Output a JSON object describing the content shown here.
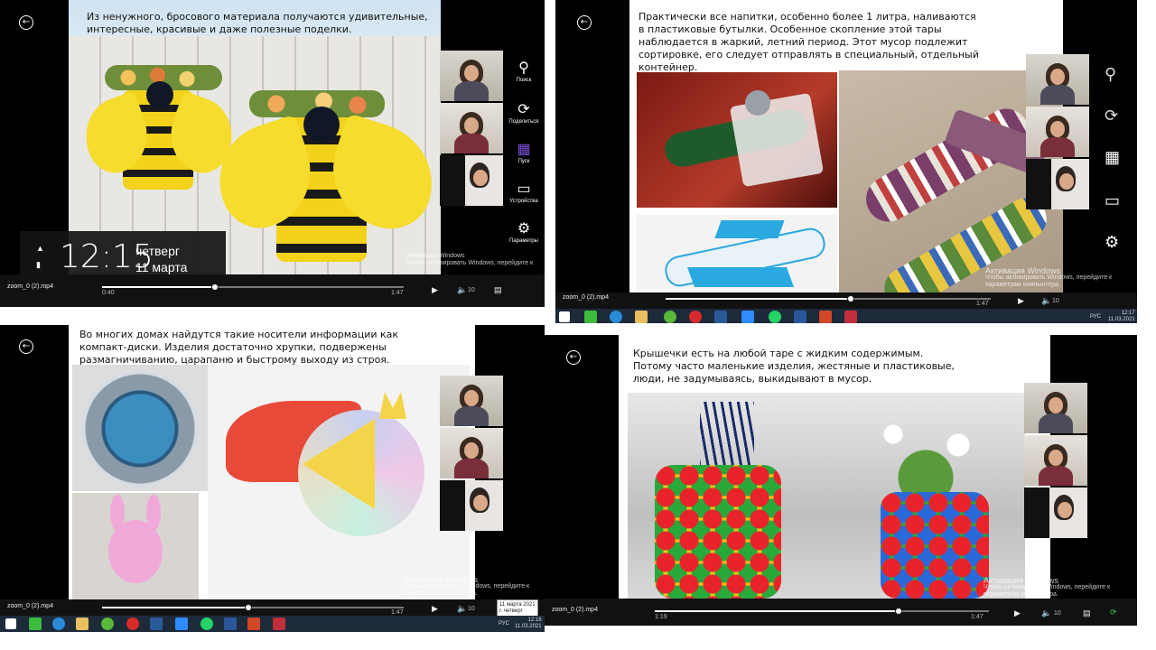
{
  "top_left": {
    "slide_text": "Из ненужного, бросового материала получаются удивительные, интересные, красивые и даже полезные поделки.",
    "file_name": "zoom_0 (2).mp4",
    "time_current": "0:40",
    "time_total": "1:47",
    "volume": "10",
    "clock": {
      "time": "12:15",
      "day": "четверг",
      "date": "11 марта"
    },
    "charms": [
      {
        "icon": "search-icon",
        "label": "Поиск"
      },
      {
        "icon": "share-icon",
        "label": "Поделиться"
      },
      {
        "icon": "windows-start-icon",
        "label": "Пуск"
      },
      {
        "icon": "devices-icon",
        "label": "Устройства"
      },
      {
        "icon": "gear-icon",
        "label": "Параметры"
      }
    ],
    "watermark": [
      "Активация Windows",
      "Чтобы активировать Windows, перейдите к"
    ]
  },
  "top_right": {
    "slide_text": "Практически все напитки, особенно более 1 литра, наливаются в пластиковые бутылки. Особенное скопление этой тары наблюдается в жаркий, летний период. Этот мусор подлежит сортировке, его следует отправлять в специальный, отдельный контейнер.",
    "file_name": "zoom_0 (2).mp4",
    "time_total": "1:47",
    "volume": "10",
    "tray_lang": "РУС",
    "tray_time": "12:17",
    "tray_date": "11.03.2021",
    "watermark": [
      "Активация Windows",
      "Чтобы активировать Windows, перейдите к",
      "параметрам компьютера."
    ]
  },
  "bottom_left": {
    "slide_text": "Во многих домах найдутся такие носители информации как компакт-диски. Изделия достаточно хрупки, подвержены размагничиванию, царапаню и быстрому выходу из строя.",
    "file_name": "zoom_0 (2).mp4",
    "time_total": "1:47",
    "volume": "10",
    "tooltip": "11 марта 2021 г. четверг",
    "tray_lang": "РУС",
    "tray_time": "12:16",
    "tray_date": "11.03.2021",
    "watermark": [
      "Активация Windows",
      "Чтобы активировать Windows, перейдите к",
      "параметрам компьютера."
    ]
  },
  "bottom_right": {
    "slide_text": "Крышечки есть на любой таре с жидким содержимым. Потому часто маленькие изделия, жестяные и пластиковые, люди, не задумываясь, выкидывают в мусор.",
    "file_name": "zoom_0 (2).mp4",
    "time_current": "1:19",
    "time_total": "1:47",
    "volume": "10",
    "watermark": [
      "Активация Windows",
      "Чтобы активировать Windows, перейдите к",
      "параметрам компьютера."
    ]
  },
  "taskbar_apps": [
    "start-icon",
    "app-green-icon",
    "ie-icon",
    "explorer-icon",
    "torrent-icon",
    "opera-icon",
    "media-player-icon",
    "zoom-icon",
    "whatsapp-icon",
    "word-icon",
    "powerpoint-icon",
    "slideshow-icon"
  ]
}
